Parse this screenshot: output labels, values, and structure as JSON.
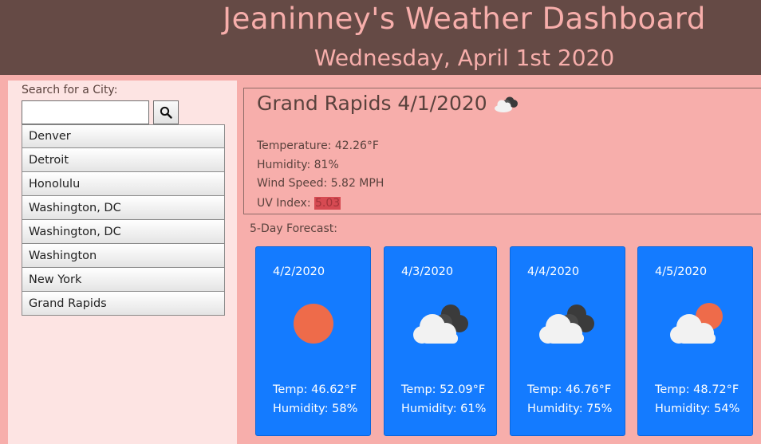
{
  "header": {
    "title": "Jeaninney's Weather Dashboard",
    "date": "Wednesday, April 1st 2020"
  },
  "sidebar": {
    "search_label": "Search for a City:",
    "search_value": "",
    "search_icon": "magnifier-icon",
    "cities": [
      {
        "label": "Denver"
      },
      {
        "label": "Detroit"
      },
      {
        "label": "Honolulu"
      },
      {
        "label": "Washington, DC"
      },
      {
        "label": "Washington, DC"
      },
      {
        "label": "Washington"
      },
      {
        "label": "New York"
      },
      {
        "label": "Grand Rapids"
      }
    ]
  },
  "current": {
    "title": "Grand Rapids 4/1/2020",
    "icon": "cloud-dark-icon",
    "temperature": "Temperature: 42.26°F",
    "humidity": "Humidity: 81%",
    "wind": "Wind Speed: 5.82 MPH",
    "uv_label": "UV Index: ",
    "uv_value": "5.03",
    "uv_color": "#d64a52"
  },
  "forecast": {
    "label": "5-Day Forecast:",
    "days": [
      {
        "date": "4/2/2020",
        "icon": "sun-icon",
        "temp": "Temp: 46.62°F",
        "humidity": "Humidity: 58%"
      },
      {
        "date": "4/3/2020",
        "icon": "cloud-dark-icon",
        "temp": "Temp: 52.09°F",
        "humidity": "Humidity: 61%"
      },
      {
        "date": "4/4/2020",
        "icon": "cloud-dark-icon",
        "temp": "Temp: 46.76°F",
        "humidity": "Humidity: 75%"
      },
      {
        "date": "4/5/2020",
        "icon": "partly-cloudy-icon",
        "temp": "Temp: 48.72°F",
        "humidity": "Humidity: 54%"
      }
    ]
  },
  "colors": {
    "header_bg": "#654a45",
    "page_bg": "#f7aeab",
    "sidebar_bg": "#fde4e3",
    "card_bg": "#147bff",
    "sun": "#ee6b4a"
  }
}
